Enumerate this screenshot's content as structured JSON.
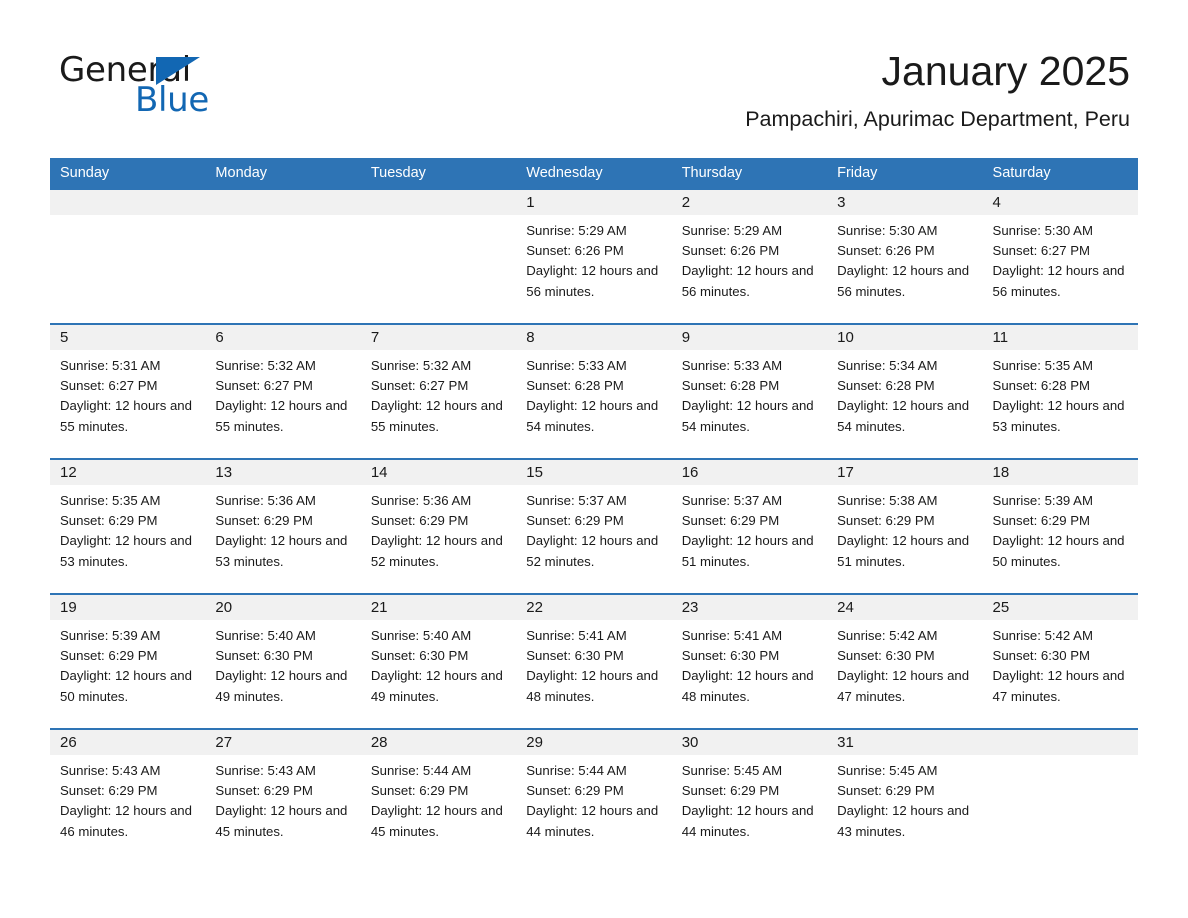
{
  "brand": {
    "name_part1": "General",
    "name_part2": "Blue",
    "accent_color": "#1267b3"
  },
  "header": {
    "title": "January 2025",
    "subtitle": "Pampachiri, Apurimac Department, Peru"
  },
  "calendar": {
    "header_bg": "#2e74b5",
    "daynum_bg": "#f1f1f1",
    "weekday_headers": [
      "Sunday",
      "Monday",
      "Tuesday",
      "Wednesday",
      "Thursday",
      "Friday",
      "Saturday"
    ],
    "weeks": [
      [
        {
          "day": "",
          "sunrise": "",
          "sunset": "",
          "daylight": ""
        },
        {
          "day": "",
          "sunrise": "",
          "sunset": "",
          "daylight": ""
        },
        {
          "day": "",
          "sunrise": "",
          "sunset": "",
          "daylight": ""
        },
        {
          "day": "1",
          "sunrise": "Sunrise: 5:29 AM",
          "sunset": "Sunset: 6:26 PM",
          "daylight": "Daylight: 12 hours and 56 minutes."
        },
        {
          "day": "2",
          "sunrise": "Sunrise: 5:29 AM",
          "sunset": "Sunset: 6:26 PM",
          "daylight": "Daylight: 12 hours and 56 minutes."
        },
        {
          "day": "3",
          "sunrise": "Sunrise: 5:30 AM",
          "sunset": "Sunset: 6:26 PM",
          "daylight": "Daylight: 12 hours and 56 minutes."
        },
        {
          "day": "4",
          "sunrise": "Sunrise: 5:30 AM",
          "sunset": "Sunset: 6:27 PM",
          "daylight": "Daylight: 12 hours and 56 minutes."
        }
      ],
      [
        {
          "day": "5",
          "sunrise": "Sunrise: 5:31 AM",
          "sunset": "Sunset: 6:27 PM",
          "daylight": "Daylight: 12 hours and 55 minutes."
        },
        {
          "day": "6",
          "sunrise": "Sunrise: 5:32 AM",
          "sunset": "Sunset: 6:27 PM",
          "daylight": "Daylight: 12 hours and 55 minutes."
        },
        {
          "day": "7",
          "sunrise": "Sunrise: 5:32 AM",
          "sunset": "Sunset: 6:27 PM",
          "daylight": "Daylight: 12 hours and 55 minutes."
        },
        {
          "day": "8",
          "sunrise": "Sunrise: 5:33 AM",
          "sunset": "Sunset: 6:28 PM",
          "daylight": "Daylight: 12 hours and 54 minutes."
        },
        {
          "day": "9",
          "sunrise": "Sunrise: 5:33 AM",
          "sunset": "Sunset: 6:28 PM",
          "daylight": "Daylight: 12 hours and 54 minutes."
        },
        {
          "day": "10",
          "sunrise": "Sunrise: 5:34 AM",
          "sunset": "Sunset: 6:28 PM",
          "daylight": "Daylight: 12 hours and 54 minutes."
        },
        {
          "day": "11",
          "sunrise": "Sunrise: 5:35 AM",
          "sunset": "Sunset: 6:28 PM",
          "daylight": "Daylight: 12 hours and 53 minutes."
        }
      ],
      [
        {
          "day": "12",
          "sunrise": "Sunrise: 5:35 AM",
          "sunset": "Sunset: 6:29 PM",
          "daylight": "Daylight: 12 hours and 53 minutes."
        },
        {
          "day": "13",
          "sunrise": "Sunrise: 5:36 AM",
          "sunset": "Sunset: 6:29 PM",
          "daylight": "Daylight: 12 hours and 53 minutes."
        },
        {
          "day": "14",
          "sunrise": "Sunrise: 5:36 AM",
          "sunset": "Sunset: 6:29 PM",
          "daylight": "Daylight: 12 hours and 52 minutes."
        },
        {
          "day": "15",
          "sunrise": "Sunrise: 5:37 AM",
          "sunset": "Sunset: 6:29 PM",
          "daylight": "Daylight: 12 hours and 52 minutes."
        },
        {
          "day": "16",
          "sunrise": "Sunrise: 5:37 AM",
          "sunset": "Sunset: 6:29 PM",
          "daylight": "Daylight: 12 hours and 51 minutes."
        },
        {
          "day": "17",
          "sunrise": "Sunrise: 5:38 AM",
          "sunset": "Sunset: 6:29 PM",
          "daylight": "Daylight: 12 hours and 51 minutes."
        },
        {
          "day": "18",
          "sunrise": "Sunrise: 5:39 AM",
          "sunset": "Sunset: 6:29 PM",
          "daylight": "Daylight: 12 hours and 50 minutes."
        }
      ],
      [
        {
          "day": "19",
          "sunrise": "Sunrise: 5:39 AM",
          "sunset": "Sunset: 6:29 PM",
          "daylight": "Daylight: 12 hours and 50 minutes."
        },
        {
          "day": "20",
          "sunrise": "Sunrise: 5:40 AM",
          "sunset": "Sunset: 6:30 PM",
          "daylight": "Daylight: 12 hours and 49 minutes."
        },
        {
          "day": "21",
          "sunrise": "Sunrise: 5:40 AM",
          "sunset": "Sunset: 6:30 PM",
          "daylight": "Daylight: 12 hours and 49 minutes."
        },
        {
          "day": "22",
          "sunrise": "Sunrise: 5:41 AM",
          "sunset": "Sunset: 6:30 PM",
          "daylight": "Daylight: 12 hours and 48 minutes."
        },
        {
          "day": "23",
          "sunrise": "Sunrise: 5:41 AM",
          "sunset": "Sunset: 6:30 PM",
          "daylight": "Daylight: 12 hours and 48 minutes."
        },
        {
          "day": "24",
          "sunrise": "Sunrise: 5:42 AM",
          "sunset": "Sunset: 6:30 PM",
          "daylight": "Daylight: 12 hours and 47 minutes."
        },
        {
          "day": "25",
          "sunrise": "Sunrise: 5:42 AM",
          "sunset": "Sunset: 6:30 PM",
          "daylight": "Daylight: 12 hours and 47 minutes."
        }
      ],
      [
        {
          "day": "26",
          "sunrise": "Sunrise: 5:43 AM",
          "sunset": "Sunset: 6:29 PM",
          "daylight": "Daylight: 12 hours and 46 minutes."
        },
        {
          "day": "27",
          "sunrise": "Sunrise: 5:43 AM",
          "sunset": "Sunset: 6:29 PM",
          "daylight": "Daylight: 12 hours and 45 minutes."
        },
        {
          "day": "28",
          "sunrise": "Sunrise: 5:44 AM",
          "sunset": "Sunset: 6:29 PM",
          "daylight": "Daylight: 12 hours and 45 minutes."
        },
        {
          "day": "29",
          "sunrise": "Sunrise: 5:44 AM",
          "sunset": "Sunset: 6:29 PM",
          "daylight": "Daylight: 12 hours and 44 minutes."
        },
        {
          "day": "30",
          "sunrise": "Sunrise: 5:45 AM",
          "sunset": "Sunset: 6:29 PM",
          "daylight": "Daylight: 12 hours and 44 minutes."
        },
        {
          "day": "31",
          "sunrise": "Sunrise: 5:45 AM",
          "sunset": "Sunset: 6:29 PM",
          "daylight": "Daylight: 12 hours and 43 minutes."
        },
        {
          "day": "",
          "sunrise": "",
          "sunset": "",
          "daylight": ""
        }
      ]
    ]
  }
}
